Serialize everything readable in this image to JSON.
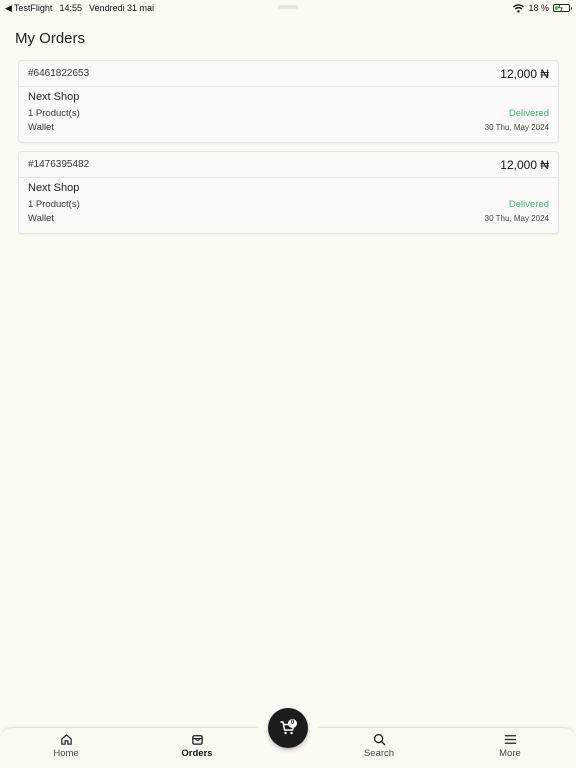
{
  "status_bar": {
    "back_app": "TestFlight",
    "time": "14:55",
    "date": "Vendredi 31 mai",
    "battery": "18 %"
  },
  "page": {
    "title": "My Orders"
  },
  "orders": [
    {
      "id": "#6461822653",
      "total": "12,000 ₦",
      "shop": "Next Shop",
      "products": "1 Product(s)",
      "status": "Delivered",
      "payment": "Wallet",
      "date": "30 Thu, May 2024"
    },
    {
      "id": "#1476395482",
      "total": "12,000 ₦",
      "shop": "Next Shop",
      "products": "1 Product(s)",
      "status": "Delivered",
      "payment": "Wallet",
      "date": "30 Thu, May 2024"
    }
  ],
  "nav": {
    "home": "Home",
    "orders": "Orders",
    "search": "Search",
    "more": "More",
    "cart_count": "0"
  },
  "colors": {
    "background": "#fdfaf4",
    "delivered": "#3cb371",
    "fab": "#1c1c1c"
  }
}
